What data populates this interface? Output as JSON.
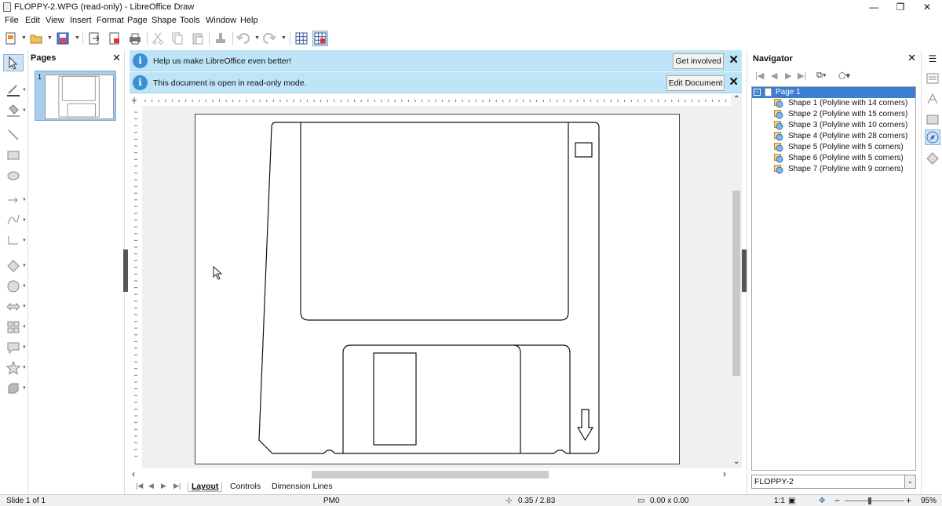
{
  "window": {
    "title": "FLOPPY-2.WPG (read-only) - LibreOffice Draw",
    "minimize": "—",
    "restore": "❐",
    "close": "✕"
  },
  "menu": [
    "File",
    "Edit",
    "View",
    "Insert",
    "Format",
    "Page",
    "Shape",
    "Tools",
    "Window",
    "Help"
  ],
  "pages_panel": {
    "title": "Pages",
    "close": "✕",
    "thumbnail_number": "1"
  },
  "infobars": [
    {
      "text": "Help us make LibreOffice even better!",
      "button": "Get involved"
    },
    {
      "text": "This document is open in read-only mode.",
      "button": "Edit Document"
    }
  ],
  "infobar_icon_glyph": "i",
  "infobar_close_glyph": "✕",
  "tabs": {
    "items": [
      "Layout",
      "Controls",
      "Dimension Lines"
    ],
    "active": "Layout",
    "nav": [
      "|◀",
      "◀",
      "▶",
      "▶|"
    ]
  },
  "navigator": {
    "title": "Navigator",
    "close": "✕",
    "tree_toggle": "−",
    "page_label": "Page 1",
    "shapes": [
      "Shape 1 (Polyline with 14 corners)",
      "Shape 2 (Polyline with 15 corners)",
      "Shape 3 (Polyline with 10 corners)",
      "Shape 4 (Polyline with 28 corners)",
      "Shape 5 (Polyline with 5 corners)",
      "Shape 6 (Polyline with 5 corners)",
      "Shape 7 (Polyline with 9 corners)"
    ],
    "document_select": "FLOPPY-2",
    "document_select_arrow": "⌄"
  },
  "scroll_arrows": {
    "up": "⌃",
    "down": "⌄",
    "left": "‹",
    "right": "›"
  },
  "status": {
    "slide": "Slide 1 of 1",
    "layout_name": "PM0",
    "position": "0.35 / 2.83",
    "size": "0.00 x 0.00",
    "scale": "1:1",
    "zoom_minus": "−",
    "zoom_plus": "+",
    "zoom": "95%"
  },
  "colors": {
    "infobar_bg": "#bde4f7",
    "selection": "#3c7fd1",
    "thumbnail_bg": "#a9cdee"
  }
}
